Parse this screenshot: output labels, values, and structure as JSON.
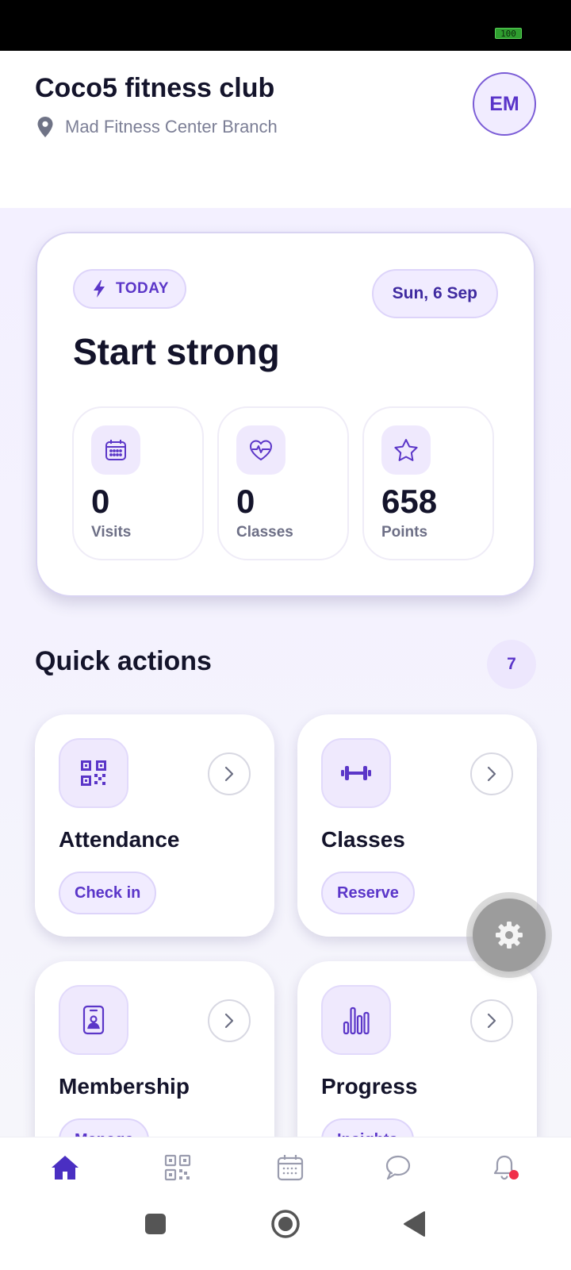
{
  "status_bar": {
    "battery": "100"
  },
  "header": {
    "club_name": "Coco5 fitness club",
    "branch": "Mad Fitness Center Branch",
    "avatar_initials": "EM"
  },
  "today_card": {
    "badge": "TODAY",
    "date": "Sun, 6 Sep",
    "heading": "Start strong",
    "stats": [
      {
        "value": "0",
        "label": "Visits",
        "icon": "calendar-icon"
      },
      {
        "value": "0",
        "label": "Classes",
        "icon": "heart-pulse-icon"
      },
      {
        "value": "658",
        "label": "Points",
        "icon": "star-icon"
      }
    ]
  },
  "quick_actions": {
    "title": "Quick actions",
    "count": "7",
    "items": [
      {
        "title": "Attendance",
        "action": "Check in",
        "icon": "qr-code-icon"
      },
      {
        "title": "Classes",
        "action": "Reserve",
        "icon": "dumbbell-icon"
      },
      {
        "title": "Membership",
        "action": "Manage",
        "icon": "member-card-icon"
      },
      {
        "title": "Progress",
        "action": "Insights",
        "icon": "bar-chart-icon"
      }
    ]
  },
  "bottom_nav": {
    "items": [
      "home-icon",
      "qr-code-icon",
      "calendar-icon",
      "chat-icon",
      "bell-icon"
    ],
    "active": "home-icon",
    "notification_dot_color": "#f0304a"
  },
  "colors": {
    "accent": "#5a35c9",
    "accent_soft": "#f1ecff",
    "text_primary": "#14142b",
    "text_secondary": "#6d6f86"
  }
}
